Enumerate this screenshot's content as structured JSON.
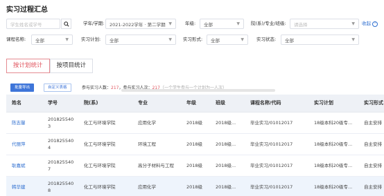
{
  "page": {
    "title": "实习过程汇总"
  },
  "filters": {
    "student_placeholder": "学生姓名或学号",
    "term_label": "学年/学期:",
    "term_value": "2021-2022学年 · 第二学期",
    "grade_label": "年级:",
    "grade_value": "全部",
    "dept_label": "院(系)/专业/班级:",
    "dept_placeholder": "请选择",
    "collapse_label": "收起",
    "course_label": "课程名称:",
    "course_value": "全部",
    "plan_label": "实习计划:",
    "plan_value": "全部",
    "form_label": "实习形式:",
    "form_value": "全部",
    "status_label": "实习状态:",
    "status_value": "全部"
  },
  "tabs": [
    {
      "label": "按计划统计",
      "active": true
    },
    {
      "label": "按项目统计",
      "active": false
    }
  ],
  "toolbar": {
    "export_label": "批量导出",
    "custom_label": "自定义表格",
    "stats_prefix": "参与实习人数：",
    "stats_people": "217",
    "stats_mid": "，参与实习人次：",
    "stats_times": "217",
    "stats_note": "（一个学生参与一个计划为一人次）"
  },
  "table": {
    "columns": [
      "姓名",
      "学号",
      "院(系)",
      "专业",
      "年级",
      "班级",
      "课程名称/代码",
      "实习计划",
      "实习形式"
    ],
    "rows": [
      {
        "name": "陈志馨",
        "id_a": "201825540",
        "id_b": "3",
        "dept": "化工与环境学院",
        "major": "应用化学",
        "grade": "2018级",
        "class_a": "2018级...",
        "course": "毕业实习/01012017",
        "plan": "18级本科20级专...",
        "form": "自主安排"
      },
      {
        "name": "代丽萍",
        "id_a": "201825540",
        "id_b": "4",
        "dept": "化工与环境学院",
        "major": "环境工程",
        "grade": "2018级",
        "class_a": "2018级...",
        "course": "毕业实习/01012017",
        "plan": "18级本科20级专...",
        "form": "自主安排"
      },
      {
        "name": "耿嘉斌",
        "id_a": "201825540",
        "id_b": "7",
        "dept": "化工与环境学院",
        "major": "高分子材料与工程",
        "grade": "2018级",
        "class_a": "2018级...",
        "course": "毕业实习/01012017",
        "plan": "18级本科20级专...",
        "form": "自主安排"
      },
      {
        "name": "韩华建",
        "id_a": "201825540",
        "id_b": "8",
        "dept": "化工与环境学院",
        "major": "应用化学",
        "grade": "2018级",
        "class_a": "2018级...",
        "course": "毕业实习/01012017",
        "plan": "18级本科20级专...",
        "form": "自主安排"
      }
    ]
  },
  "colors": {
    "accent": "#3e75d9",
    "active_tab": "#e0525c",
    "link": "#2f6fd0",
    "highlight_row": "#eef4fc"
  },
  "icons": {
    "search": "search-icon",
    "caret": "chevron-down-icon",
    "collapse": "chevron-up-icon"
  }
}
